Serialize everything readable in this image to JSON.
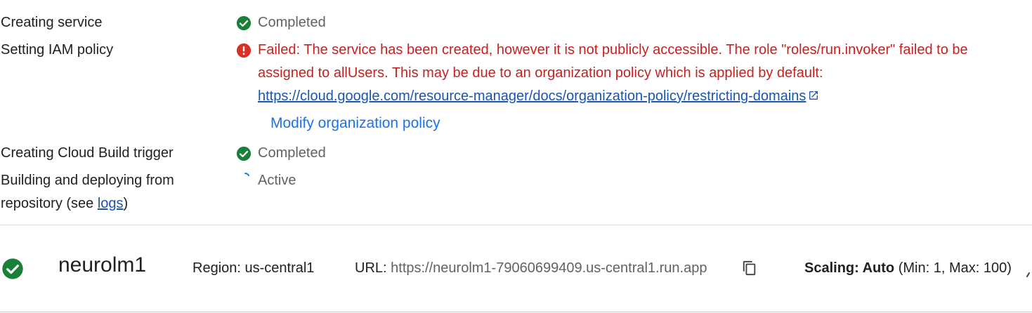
{
  "steps": [
    {
      "label": "Creating service",
      "status": "Completed"
    },
    {
      "label": "Setting IAM policy",
      "status": "Failed: The service has been created, however it is not publicly accessible. The role \"roles/run.invoker\" failed to be assigned to allUsers. This may be due to an organization policy which is applied by default:",
      "link": "https://cloud.google.com/resource-manager/docs/organization-policy/restricting-domains",
      "action": "Modify organization policy"
    },
    {
      "label": "Creating Cloud Build trigger",
      "status": "Completed"
    },
    {
      "label_prefix": "Building and deploying from repository (see ",
      "label_link": "logs",
      "label_suffix": ")",
      "status": "Active"
    }
  ],
  "service": {
    "name": "neurolm1",
    "region": "Region: us-central1",
    "url_label": "URL:",
    "url": "https://neurolm1-79060699409.us-central1.run.app",
    "scaling_label": "Scaling: Auto",
    "scaling_detail": "(Min: 1, Max: 100)"
  },
  "colors": {
    "success": "#188038",
    "error": "#d93025",
    "link": "#1a73e8"
  },
  "icons": {
    "completed": "check-circle-icon",
    "failed": "error-circle-icon",
    "external": "open-in-new-icon",
    "copy": "copy-icon",
    "active": "spinner-icon"
  }
}
